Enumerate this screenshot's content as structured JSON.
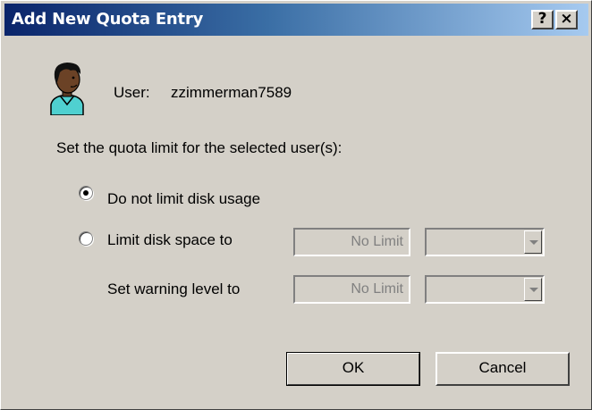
{
  "window": {
    "title": "Add New Quota Entry",
    "help_button": "?",
    "close_button": "×"
  },
  "user": {
    "label": "User:",
    "name": "zzimmerman7589",
    "icon": "user-avatar-icon"
  },
  "quota": {
    "prompt": "Set the quota limit for the selected user(s):",
    "options": [
      {
        "label": "Do not limit disk usage",
        "selected": true
      },
      {
        "label": "Limit disk space to",
        "selected": false
      }
    ],
    "warning_label": "Set warning level to",
    "limit_value": "No Limit",
    "warning_value": "No Limit",
    "limit_unit": "",
    "warning_unit": ""
  },
  "buttons": {
    "ok": "OK",
    "cancel": "Cancel"
  },
  "colors": {
    "dialog_bg": "#d4d0c8",
    "title_gradient_start": "#0a246a",
    "title_gradient_end": "#a6caf0",
    "disabled_text": "#808080"
  }
}
